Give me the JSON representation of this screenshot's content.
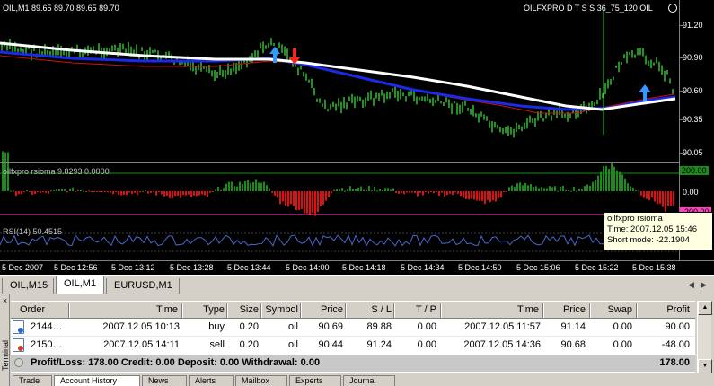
{
  "chart": {
    "title": "OIL,M1  89.65 89.70 89.65 89.70",
    "indicator_label": "OILFXPRO D T S S 36_75_120 OIL",
    "price_labels": [
      "91.20",
      "90.90",
      "90.60",
      "90.35",
      "90.05"
    ],
    "sub1_label": "oilfxpro rsioma 9.8293 0.0000",
    "sub1_box_top": "200.00",
    "sub1_zero": "0.00",
    "sub1_box_bottom": "-200.00",
    "sub2_label": "RSI(14) 50.4515",
    "time_labels": [
      "5 Dec 2007",
      "5 Dec 12:56",
      "5 Dec 13:12",
      "5 Dec 13:28",
      "5 Dec 13:44",
      "5 Dec 14:00",
      "5 Dec 14:18",
      "5 Dec 14:34",
      "5 Dec 14:50",
      "5 Dec 15:06",
      "5 Dec 15:22",
      "5 Dec 15:38"
    ],
    "tooltip": {
      "line1": "oilfxpro rsioma",
      "line2": "Time: 2007.12.05 15:46",
      "line3": "Short mode: -22.1904"
    },
    "colors": {
      "candle": "#33cc33",
      "ma_white": "#ffffff",
      "ma_blue": "#1a2ae6",
      "ma_red": "#cc1111",
      "hist_pos": "#1a8c1a",
      "hist_neg": "#dd1111",
      "rsi_line": "#4a6ad0",
      "arrow_up": "#3399ff",
      "arrow_down": "#ff2020"
    }
  },
  "chart_tabs": [
    "OIL,M15",
    "OIL,M1",
    "EURUSD,M1"
  ],
  "active_chart_tab": "OIL,M1",
  "terminal": {
    "side_label": "Terminal",
    "columns": [
      "Order",
      "Time",
      "Type",
      "Size",
      "Symbol",
      "Price",
      "S / L",
      "T / P",
      "Time",
      "Price",
      "Swap",
      "Profit"
    ],
    "rows": [
      {
        "icon": "buy",
        "order": "2144…",
        "open_time": "2007.12.05 10:13",
        "type": "buy",
        "size": "0.20",
        "symbol": "oil",
        "price": "90.69",
        "sl": "89.88",
        "tp": "0.00",
        "close_time": "2007.12.05 11:57",
        "close_price": "91.14",
        "swap": "0.00",
        "profit": "90.00"
      },
      {
        "icon": "sell",
        "order": "2150…",
        "open_time": "2007.12.05 14:11",
        "type": "sell",
        "size": "0.20",
        "symbol": "oil",
        "price": "90.44",
        "sl": "91.24",
        "tp": "0.00",
        "close_time": "2007.12.05 14:36",
        "close_price": "90.68",
        "swap": "0.00",
        "profit": "-48.00"
      }
    ],
    "summary": "Profit/Loss: 178.00  Credit: 0.00  Deposit: 0.00  Withdrawal: 0.00",
    "summary_total": "178.00",
    "bottom_tabs": [
      "Trade",
      "Account History",
      "News",
      "Alerts",
      "Mailbox",
      "Experts",
      "Journal"
    ],
    "active_bottom_tab": "Account History"
  }
}
